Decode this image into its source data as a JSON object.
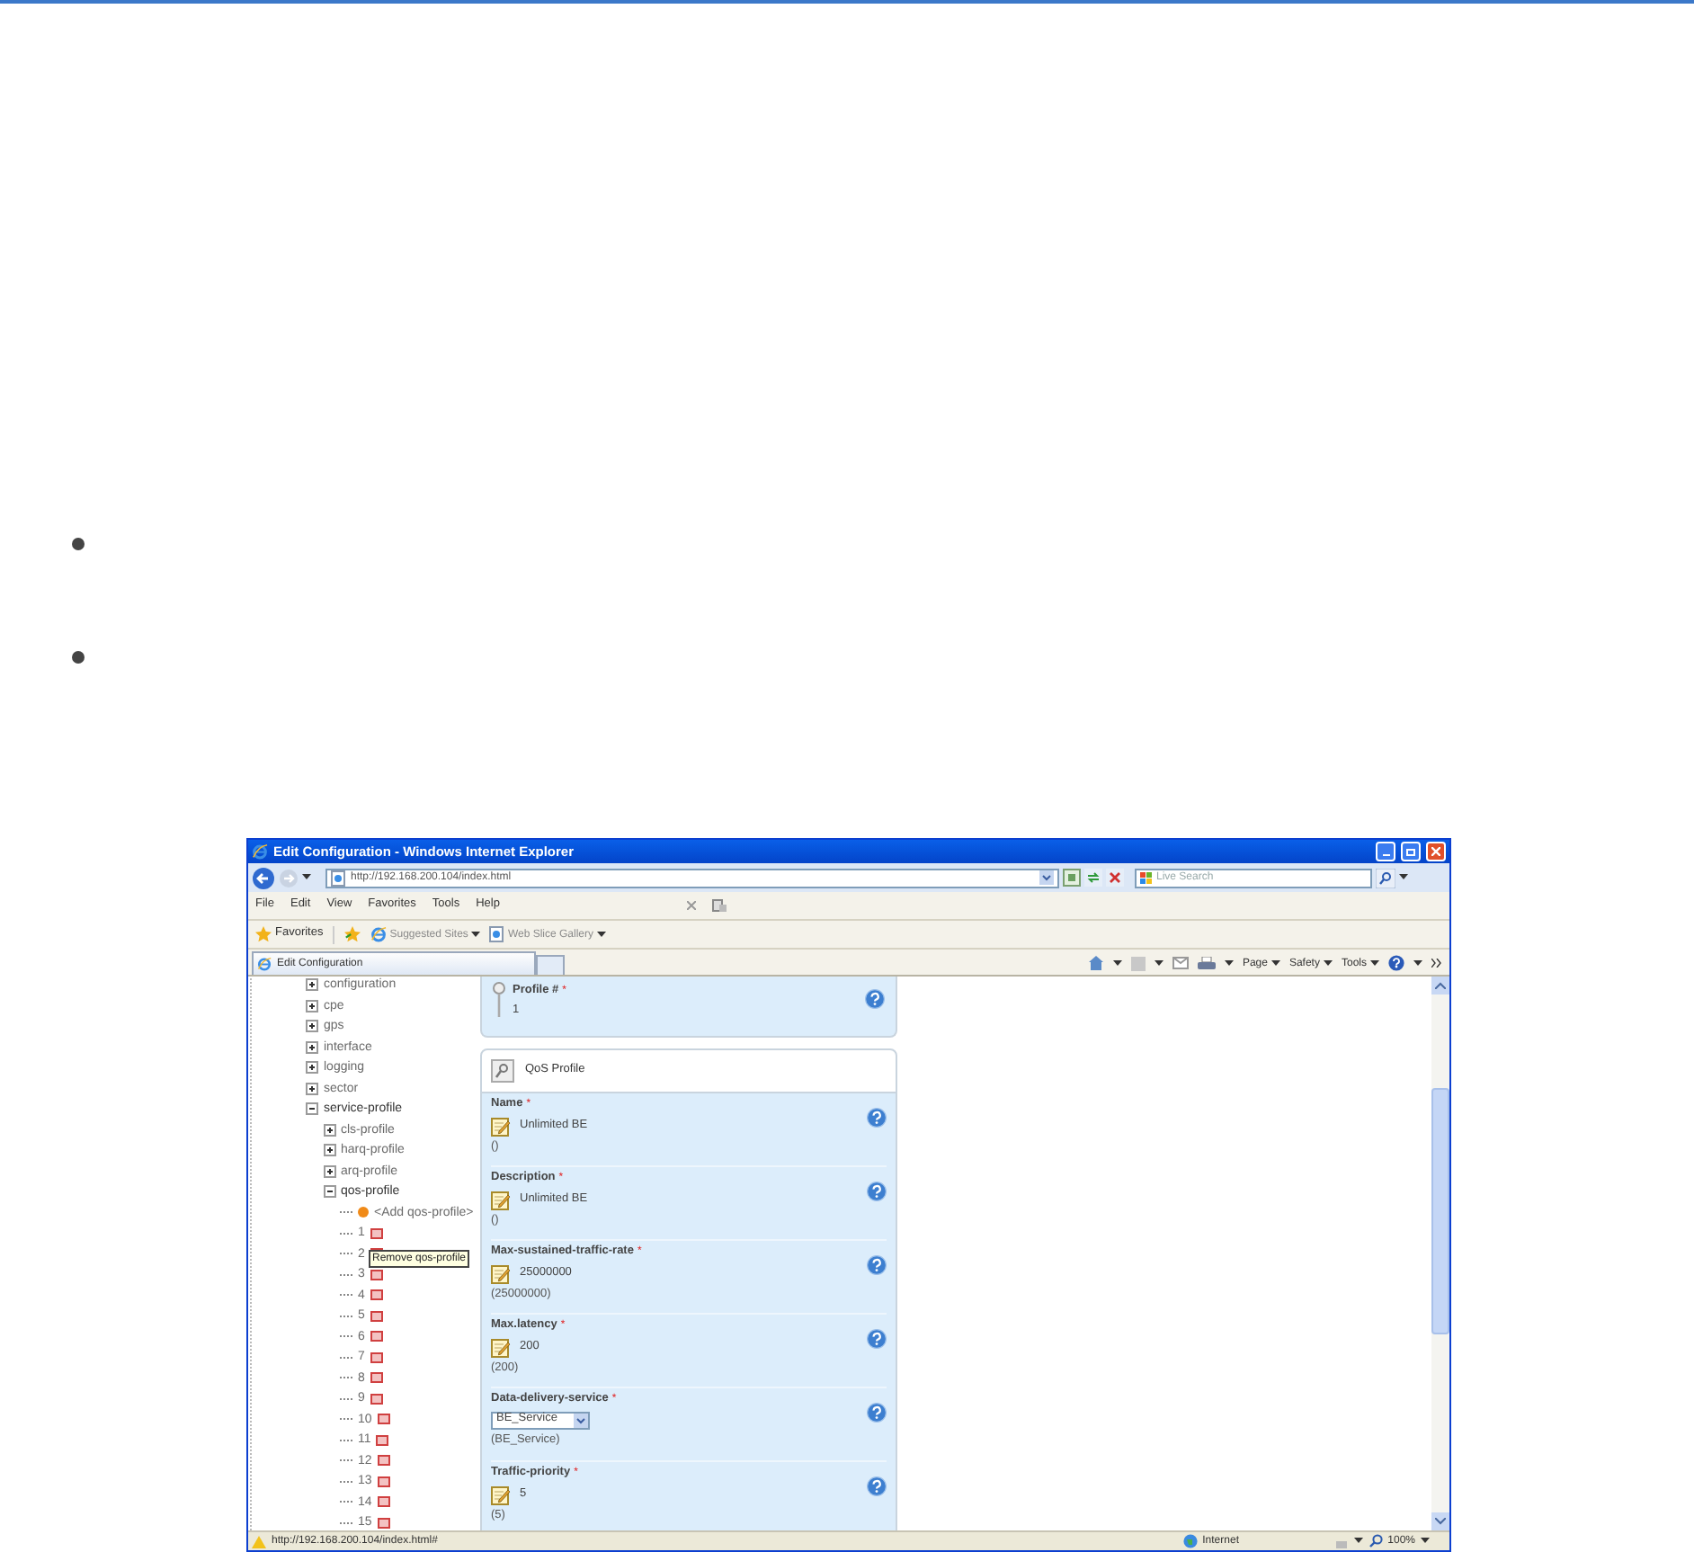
{
  "bullets": [
    {
      "kind": "bullet"
    },
    {
      "kind": "bullet"
    }
  ],
  "browser": {
    "title": "Edit Configuration - Windows Internet Explorer",
    "address": "http://192.168.200.104/index.html",
    "search_placeholder": "Live Search",
    "menu": [
      "File",
      "Edit",
      "View",
      "Favorites",
      "Tools",
      "Help"
    ],
    "favorites_label": "Favorites",
    "favorite_links": [
      "Suggested Sites",
      "Web Slice Gallery"
    ],
    "tab": "Edit Configuration",
    "commands": [
      "Page",
      "Safety",
      "Tools"
    ],
    "status_url": "http://192.168.200.104/index.html#",
    "zone": "Internet",
    "zoom": "100%"
  },
  "tree": [
    {
      "label": "configuration",
      "kind": "folder",
      "expanded": false
    },
    {
      "label": "cpe",
      "kind": "folder",
      "expanded": false
    },
    {
      "label": "gps",
      "kind": "folder",
      "expanded": false
    },
    {
      "label": "interface",
      "kind": "folder",
      "expanded": false
    },
    {
      "label": "logging",
      "kind": "folder",
      "expanded": false
    },
    {
      "label": "sector",
      "kind": "folder",
      "expanded": false
    },
    {
      "label": "service-profile",
      "kind": "folder",
      "expanded": true,
      "children": [
        {
          "label": "cls-profile",
          "kind": "folder",
          "expanded": false
        },
        {
          "label": "harq-profile",
          "kind": "folder",
          "expanded": false
        },
        {
          "label": "arq-profile",
          "kind": "folder",
          "expanded": false
        },
        {
          "label": "qos-profile",
          "kind": "folder",
          "expanded": true,
          "children": [
            {
              "label": "<Add qos-profile>",
              "kind": "add"
            },
            {
              "label": "1",
              "kind": "entry"
            },
            {
              "label": "2",
              "kind": "entry"
            },
            {
              "label": "3",
              "kind": "entry"
            },
            {
              "label": "4",
              "kind": "entry"
            },
            {
              "label": "5",
              "kind": "entry"
            },
            {
              "label": "6",
              "kind": "entry"
            },
            {
              "label": "7",
              "kind": "entry"
            },
            {
              "label": "8",
              "kind": "entry"
            },
            {
              "label": "9",
              "kind": "entry"
            },
            {
              "label": "10",
              "kind": "entry"
            },
            {
              "label": "11",
              "kind": "entry"
            },
            {
              "label": "12",
              "kind": "entry"
            },
            {
              "label": "13",
              "kind": "entry"
            },
            {
              "label": "14",
              "kind": "entry"
            },
            {
              "label": "15",
              "kind": "entry"
            }
          ]
        }
      ]
    }
  ],
  "tooltip": "Remove qos-profile",
  "profile": {
    "label": "Profile #",
    "required_mark": "*",
    "value": "1"
  },
  "section_title": "QoS Profile",
  "fields": [
    {
      "label": "Name",
      "required_mark": "*",
      "kind": "text",
      "value": "Unlimited BE",
      "default": "()"
    },
    {
      "label": "Description",
      "required_mark": "*",
      "kind": "text",
      "value": "Unlimited BE",
      "default": "()"
    },
    {
      "label": "Max-sustained-traffic-rate",
      "required_mark": "*",
      "kind": "text",
      "value": "25000000",
      "default": "(25000000)"
    },
    {
      "label": "Max.latency",
      "required_mark": "*",
      "kind": "text",
      "value": "200",
      "default": "(200)"
    },
    {
      "label": "Data-delivery-service",
      "required_mark": "*",
      "kind": "select",
      "value": "BE_Service",
      "default": "(BE_Service)"
    },
    {
      "label": "Traffic-priority",
      "required_mark": "*",
      "kind": "text",
      "value": "5",
      "default": "(5)"
    }
  ]
}
